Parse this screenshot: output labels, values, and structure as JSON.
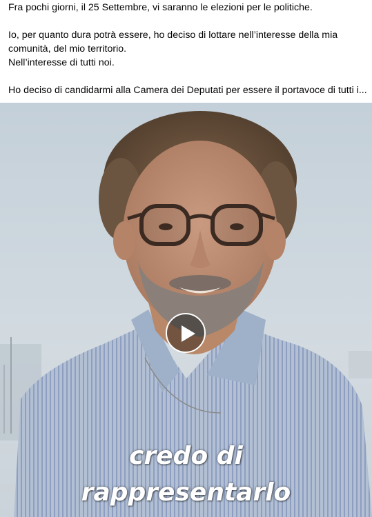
{
  "post": {
    "paragraphs": [
      "Fra pochi giorni, il 25 Settembre, vi saranno le elezioni per le politiche.",
      "Io, per quanto dura potrà essere, ho deciso di lottare nell’interesse della mia",
      "comunità, del mio territorio.",
      "Nell’interesse di tutti noi.",
      "Ho deciso di candidarmi alla Camera dei Deputati per essere il portavoce di tutti i..."
    ]
  },
  "video": {
    "caption_lines": [
      "credo di",
      "rappresentarlo"
    ],
    "play_icon": "play-icon",
    "colors": {
      "sky": "#cfd9e0",
      "shirt": "#a9b7cc",
      "caption": "#ffffff"
    }
  }
}
